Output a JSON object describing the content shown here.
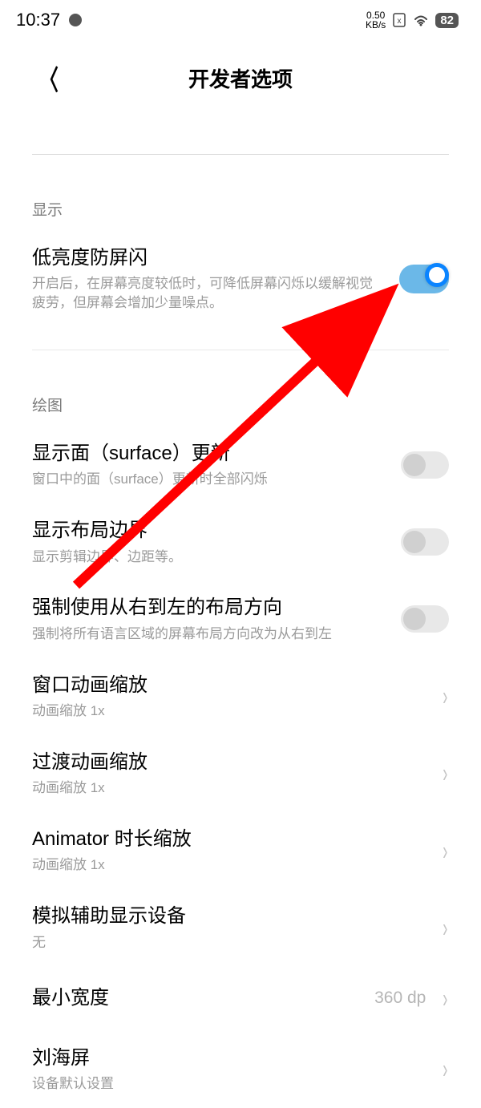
{
  "statusBar": {
    "time": "10:37",
    "kbpsTop": "0.50",
    "kbpsBottom": "KB/s",
    "battery": "82"
  },
  "header": {
    "title": "开发者选项"
  },
  "sections": {
    "display": {
      "header": "显示",
      "item1": {
        "title": "低亮度防屏闪",
        "desc": "开启后，在屏幕亮度较低时，可降低屏幕闪烁以缓解视觉疲劳，但屏幕会增加少量噪点。"
      }
    },
    "drawing": {
      "header": "绘图",
      "surfaceUpdate": {
        "title": "显示面（surface）更新",
        "desc": "窗口中的面（surface）更新时全部闪烁"
      },
      "layoutBounds": {
        "title": "显示布局边界",
        "desc": "显示剪辑边界、边距等。"
      },
      "rtl": {
        "title": "强制使用从右到左的布局方向",
        "desc": "强制将所有语言区域的屏幕布局方向改为从右到左"
      },
      "windowAnim": {
        "title": "窗口动画缩放",
        "desc": "动画缩放 1x"
      },
      "transitionAnim": {
        "title": "过渡动画缩放",
        "desc": "动画缩放 1x"
      },
      "animator": {
        "title": "Animator 时长缩放",
        "desc": "动画缩放 1x"
      },
      "simulateDisplay": {
        "title": "模拟辅助显示设备",
        "desc": "无"
      },
      "minWidth": {
        "title": "最小宽度",
        "value": "360 dp"
      },
      "notch": {
        "title": "刘海屏",
        "desc": "设备默认设置"
      }
    }
  }
}
